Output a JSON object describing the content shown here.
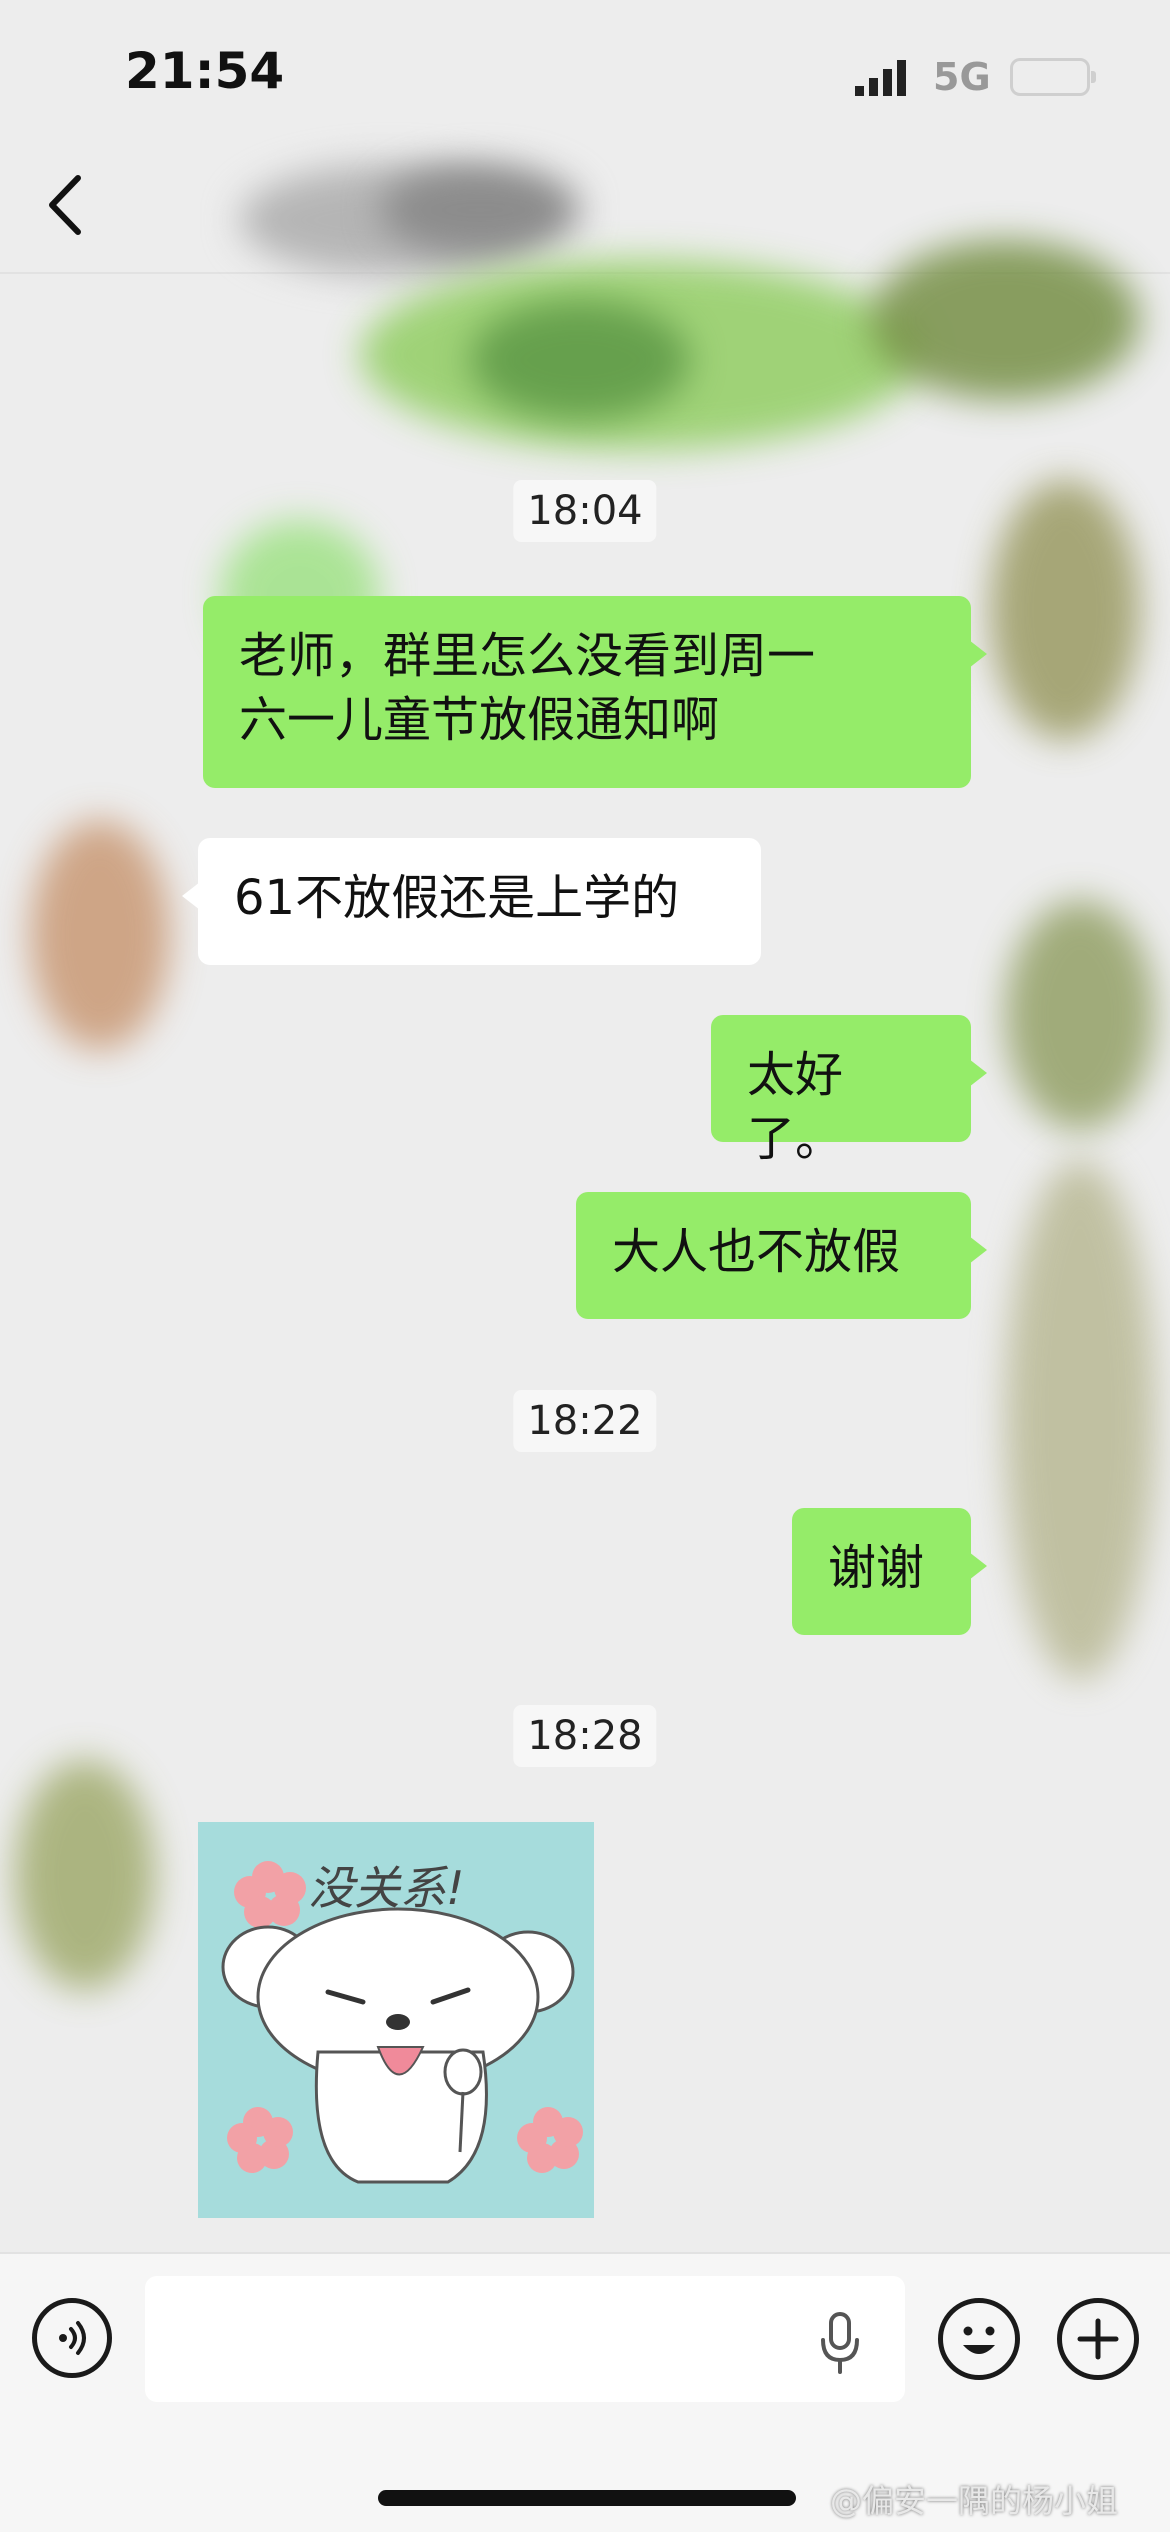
{
  "status_bar": {
    "time": "21:54",
    "network": "5G"
  },
  "messages": [
    {
      "type": "timestamp",
      "text": "18:04"
    },
    {
      "type": "sent",
      "lines": [
        "老师，群里怎么没看到周一",
        "六一儿童节放假通知啊"
      ]
    },
    {
      "type": "received",
      "text": "61不放假还是上学的"
    },
    {
      "type": "sent",
      "text": "太好了。"
    },
    {
      "type": "sent",
      "text": "大人也不放假"
    },
    {
      "type": "timestamp",
      "text": "18:22"
    },
    {
      "type": "sent",
      "text": "谢谢"
    },
    {
      "type": "timestamp",
      "text": "18:28"
    },
    {
      "type": "received-sticker",
      "sticker_text": "没关系!"
    }
  ],
  "icons": {
    "back": "chevron-left-icon",
    "voice": "voice-icon",
    "mic": "microphone-icon",
    "emoji": "emoji-icon",
    "add": "plus-icon"
  },
  "colors": {
    "sent_bubble": "#95ec69",
    "received_bubble": "#ffffff",
    "background": "#ededed"
  },
  "watermark": "@偏安一隅的杨小姐"
}
